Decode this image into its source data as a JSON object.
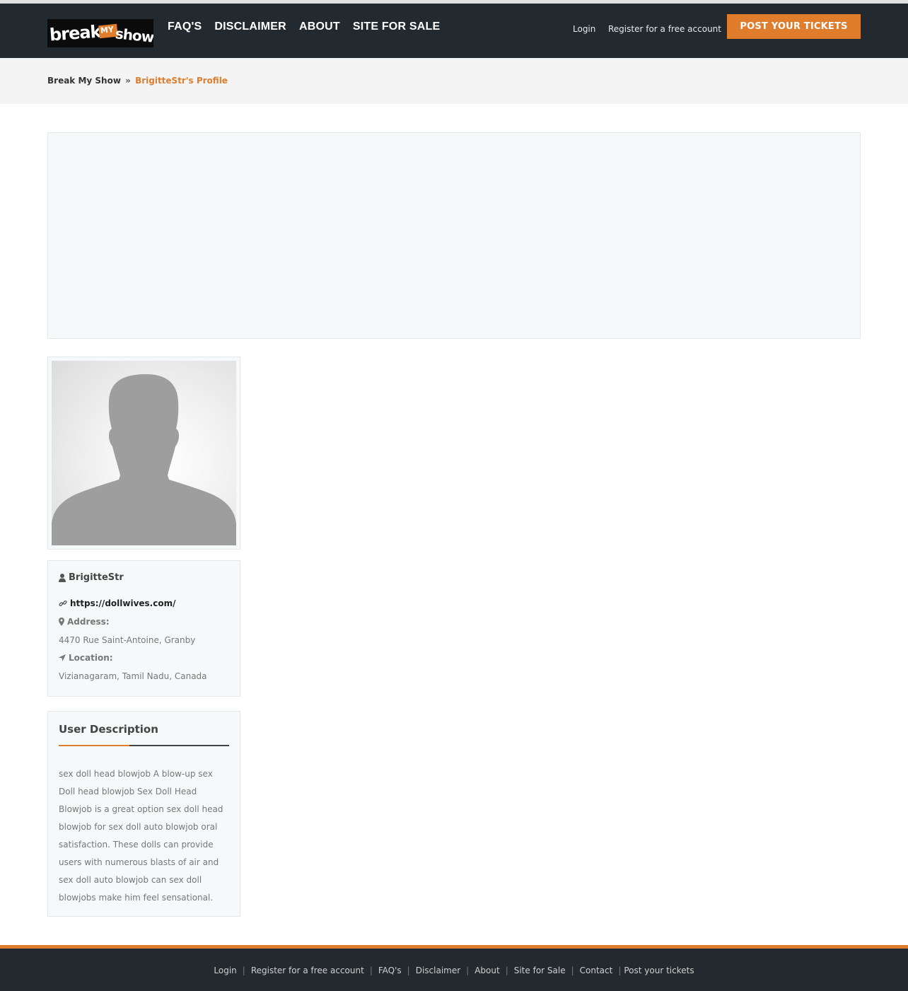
{
  "header": {
    "logo": {
      "word1": "break",
      "word2": "MY",
      "word3": "show"
    },
    "nav": [
      {
        "label": "FAQ'S"
      },
      {
        "label": "DISCLAIMER"
      },
      {
        "label": "ABOUT"
      },
      {
        "label": "SITE FOR SALE"
      }
    ],
    "login_label": "Login",
    "register_label": "Register for a free account",
    "post_button_label": "POST YOUR TICKETS"
  },
  "breadcrumb": {
    "home": "Break My Show",
    "separator": "»",
    "current": "BrigitteStr's Profile"
  },
  "profile": {
    "avatar_icon": "user-silhouette-icon",
    "username": "BrigitteStr",
    "website": "https://dollwives.com/",
    "address_label": "Address:",
    "address": "4470 Rue Saint-Antoine, Granby",
    "location_label": "Location:",
    "location": "Vizianagaram, Tamil Nadu, Canada"
  },
  "description": {
    "title": "User Description",
    "text": "sex doll head blowjob A blow-up sex Doll head blowjob Sex Doll Head Blowjob is a great option sex doll head blowjob for sex doll auto blowjob oral satisfaction. These dolls can provide users with numerous blasts of air and sex doll auto blowjob can sex doll blowjobs make him feel sensational."
  },
  "footer": {
    "links": [
      "Login",
      "Register for a free account",
      "FAQ's",
      "Disclaimer",
      "About",
      "Site for Sale",
      "Contact",
      "Post your tickets"
    ],
    "separator": "|"
  },
  "colors": {
    "accent": "#e07d2c",
    "header_bg": "#232a2f",
    "panel_bg": "#f6f9f9"
  }
}
